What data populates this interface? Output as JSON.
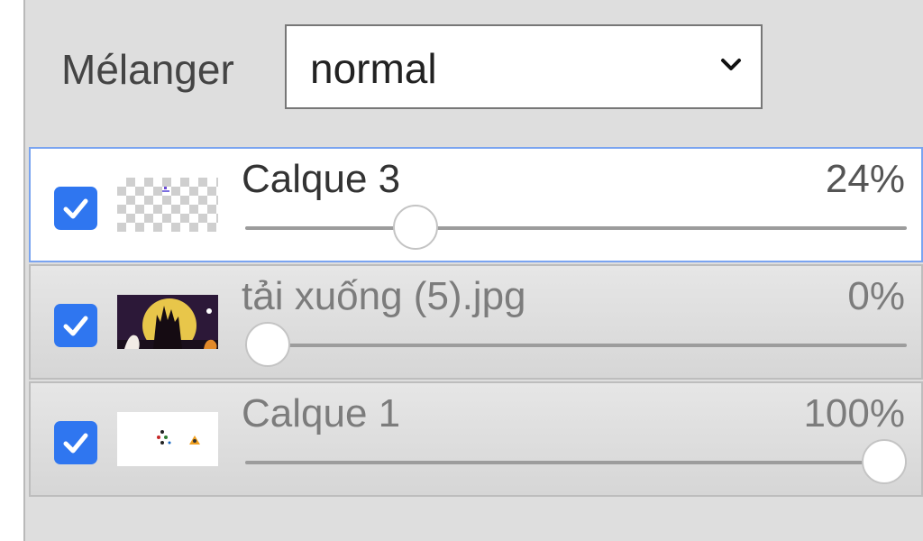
{
  "blend": {
    "label": "Mélanger",
    "value": "normal"
  },
  "layers": [
    {
      "name": "Calque 3",
      "opacity_label": "24%",
      "opacity": 0.24,
      "visible": true,
      "active": true,
      "thumbnail": "transparent"
    },
    {
      "name": "tải xuống (5).jpg",
      "opacity_label": "0%",
      "opacity": 0.0,
      "visible": true,
      "active": false,
      "thumbnail": "image"
    },
    {
      "name": "Calque 1",
      "opacity_label": "100%",
      "opacity": 1.0,
      "visible": true,
      "active": false,
      "thumbnail": "white"
    }
  ],
  "colors": {
    "accent": "#2f76f0",
    "active_border": "#7aa4f0"
  }
}
